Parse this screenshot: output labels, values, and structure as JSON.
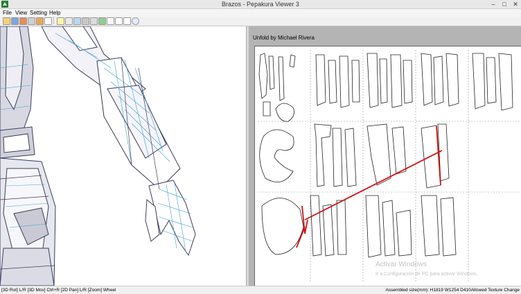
{
  "window": {
    "title": "Brazos - Pepakura Viewer 3",
    "buttons": {
      "minimize": "–",
      "maximize": "□",
      "close": "✕"
    }
  },
  "menu": [
    "File",
    "View",
    "Setting",
    "Help"
  ],
  "toolbar": {
    "icons": [
      "open-icon",
      "model-icon",
      "triangle-icon",
      "save-icon",
      "cube-icon",
      "text-icon",
      "bulb-icon",
      "3d-icon",
      "brush-icon",
      "tool-icon",
      "arrow-icon",
      "texture-icon",
      "window-icon",
      "tile-icon",
      "layout-icon",
      "info-icon"
    ]
  },
  "view2d": {
    "doc_title": "Unfold by Michael Rivera"
  },
  "status": {
    "left": "[3D Rot] L/R [3D Mov] Ctrl+R [2D Pan] L/R [Zoom] Wheel",
    "right": "Assembled size(mm): H1819 W1254 D410Allowed Texture Change"
  },
  "watermark": {
    "line1": "Activar Windows",
    "line2": "Ir a Configuración de PC para activar Windows."
  },
  "colors": {
    "model_edge": "#4a4a6a",
    "model_fill": "#ffffff",
    "fold_line": "#3aa0d0",
    "selection": "#d01010"
  }
}
